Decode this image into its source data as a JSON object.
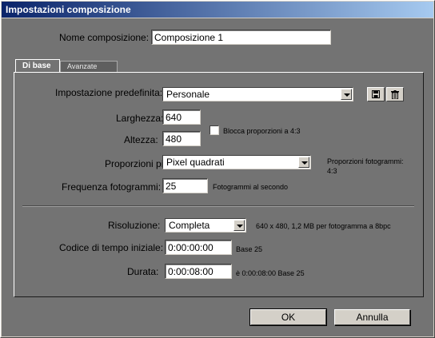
{
  "window": {
    "title": "Impostazioni composizione"
  },
  "composition_name": {
    "label": "Nome composizione:",
    "value": "Composizione 1"
  },
  "tabs": {
    "basic": "Di base",
    "advanced": "Avanzate"
  },
  "preset": {
    "label": "Impostazione predefinita:",
    "value": "Personale",
    "save_icon": "save-icon",
    "delete_icon": "trash-icon"
  },
  "width": {
    "label": "Larghezza:",
    "value": "640"
  },
  "height": {
    "label": "Altezza:",
    "value": "480"
  },
  "lock_aspect": {
    "label": "Blocca proporzioni a 4:3",
    "checked": false
  },
  "pixel_aspect": {
    "label": "Proporzioni pixel:",
    "value": "Pixel quadrati",
    "frame_aspect_label": "Proporzioni fotogrammi:",
    "frame_aspect_value": "4:3"
  },
  "frame_rate": {
    "label": "Frequenza fotogrammi:",
    "value": "25",
    "unit": "Fotogrammi al secondo"
  },
  "resolution": {
    "label": "Risoluzione:",
    "value": "Completa",
    "info": "640 x 480, 1,2 MB per fotogramma a 8bpc"
  },
  "start_timecode": {
    "label": "Codice di tempo iniziale:",
    "value": "0:00:00:00",
    "base": "Base 25"
  },
  "duration": {
    "label": "Durata:",
    "value": "0:00:08:00",
    "info": "è 0:00:08:00  Base 25"
  },
  "buttons": {
    "ok": "OK",
    "cancel": "Annulla"
  }
}
